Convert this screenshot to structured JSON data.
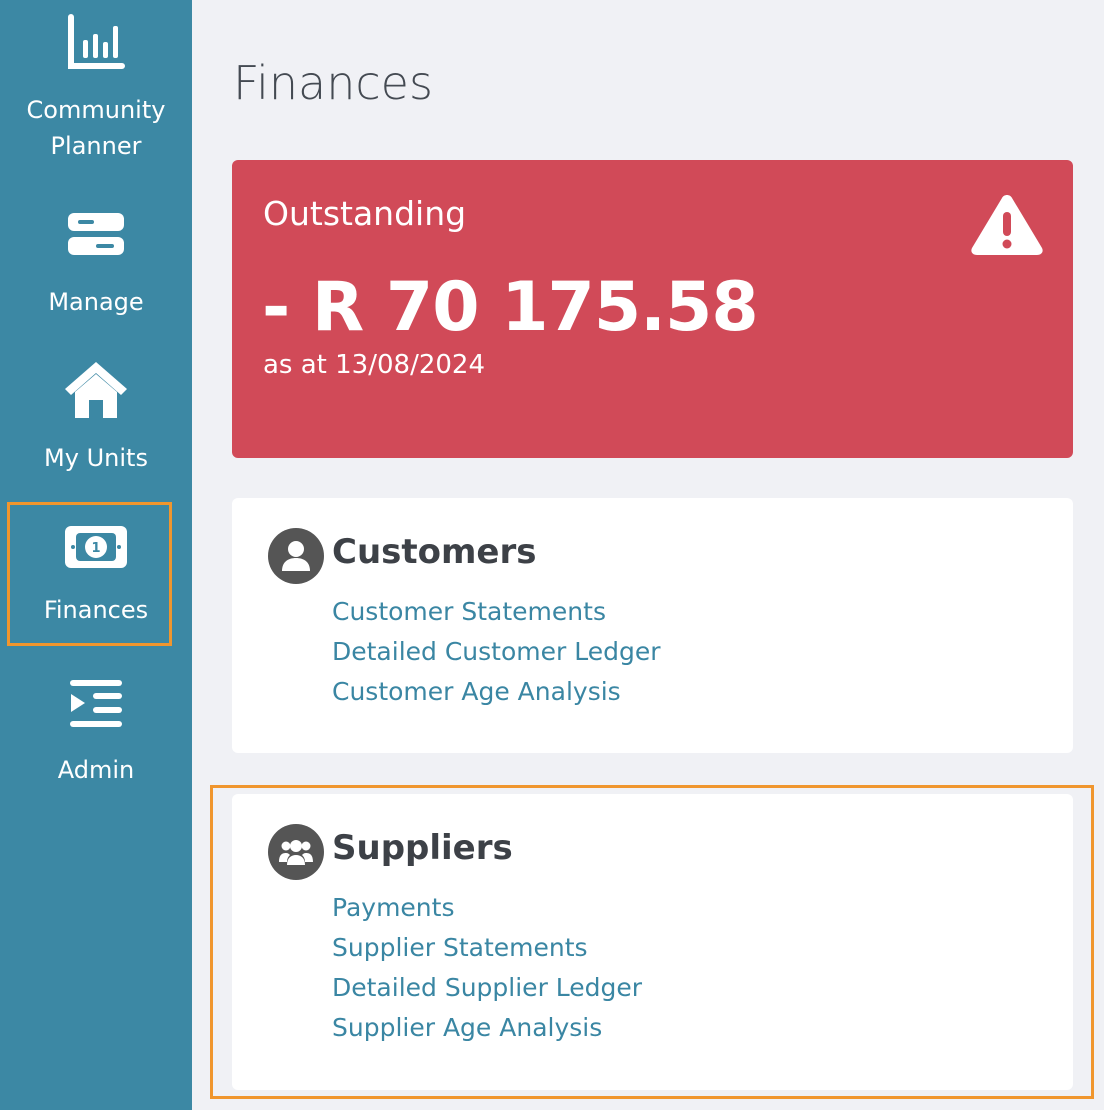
{
  "sidebar": {
    "items": [
      {
        "label": "Community\nPlanner",
        "icon": "bar-chart-icon"
      },
      {
        "label": "Manage",
        "icon": "server-icon"
      },
      {
        "label": "My Units",
        "icon": "home-icon"
      },
      {
        "label": "Finances",
        "icon": "money-bill-icon",
        "active": true
      },
      {
        "label": "Admin",
        "icon": "indent-list-icon"
      }
    ]
  },
  "page": {
    "title": "Finances"
  },
  "outstanding": {
    "title": "Outstanding",
    "amount": "- R 70 175.58",
    "as_at": "as at 13/08/2024",
    "icon": "warning-icon",
    "color": "#d14a58"
  },
  "customers": {
    "title": "Customers",
    "icon": "user-icon",
    "links": [
      "Customer Statements",
      "Detailed Customer Ledger",
      "Customer Age Analysis"
    ]
  },
  "suppliers": {
    "title": "Suppliers",
    "icon": "users-icon",
    "links": [
      "Payments",
      "Supplier Statements",
      "Detailed Supplier Ledger",
      "Supplier Age Analysis"
    ]
  },
  "colors": {
    "sidebar": "#3c88a4",
    "link": "#3a86a3",
    "highlight": "#f0962e"
  }
}
